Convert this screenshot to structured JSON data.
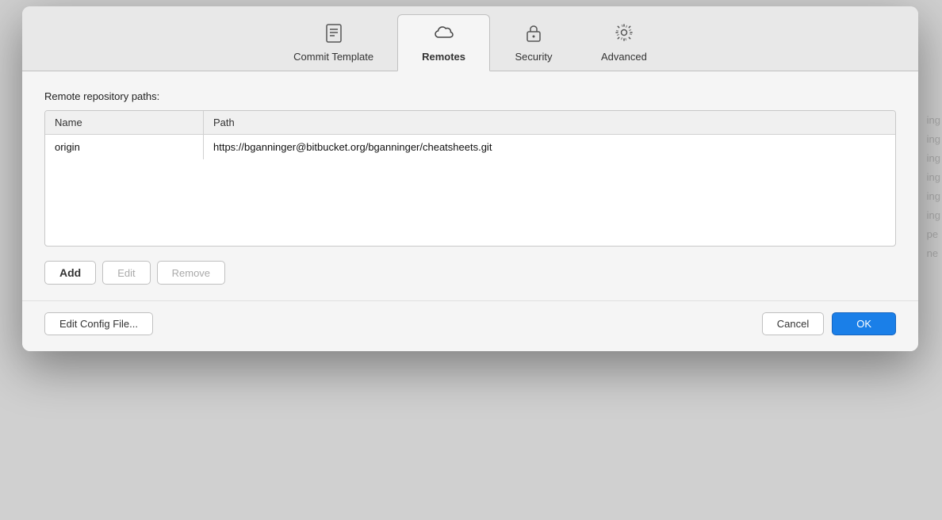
{
  "background": {
    "side_texts": [
      "ing",
      "ing",
      "ing",
      "ing",
      "ing",
      "ing",
      "pe",
      "ne"
    ]
  },
  "dialog": {
    "tabs": [
      {
        "id": "commit-template",
        "label": "Commit Template",
        "icon": "☰",
        "active": false
      },
      {
        "id": "remotes",
        "label": "Remotes",
        "icon": "☁",
        "active": true
      },
      {
        "id": "security",
        "label": "Security",
        "icon": "🔒",
        "active": false
      },
      {
        "id": "advanced",
        "label": "Advanced",
        "icon": "⚙",
        "active": false
      }
    ],
    "content": {
      "section_label": "Remote repository paths:",
      "table": {
        "columns": [
          "Name",
          "Path"
        ],
        "rows": [
          {
            "name": "origin",
            "path": "https://bganninger@bitbucket.org/bganninger/cheatsheets.git"
          }
        ]
      },
      "buttons": {
        "add": "Add",
        "edit": "Edit",
        "remove": "Remove"
      }
    },
    "footer": {
      "edit_config": "Edit Config File...",
      "cancel": "Cancel",
      "ok": "OK"
    }
  }
}
